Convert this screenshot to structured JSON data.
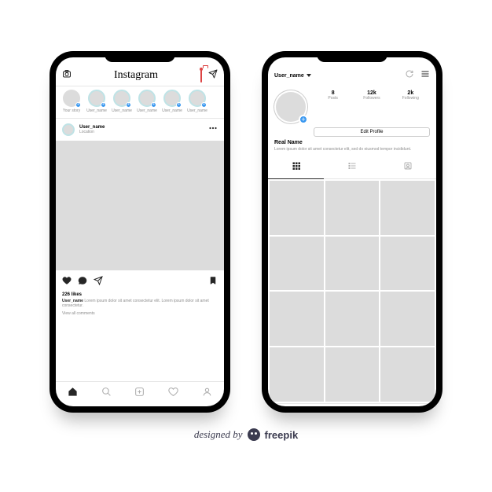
{
  "feed": {
    "app_title": "Instagram",
    "stories": [
      {
        "label": "Your story"
      },
      {
        "label": "User_name"
      },
      {
        "label": "User_name"
      },
      {
        "label": "User_name"
      },
      {
        "label": "User_name"
      },
      {
        "label": "User_name"
      }
    ],
    "post": {
      "username": "User_name",
      "location": "Location",
      "likes": "226 likes",
      "caption_user": "User_name",
      "caption": "Lorem ipsum dolor sit amet consectetur elit. Lorem ipsum dolor sit amet consectetur.",
      "view_comments": "View all comments"
    }
  },
  "profile": {
    "username": "User_name",
    "stats": [
      {
        "value": "8",
        "label": "Posts"
      },
      {
        "value": "12k",
        "label": "Followers"
      },
      {
        "value": "2k",
        "label": "Following"
      }
    ],
    "edit_label": "Edit Profile",
    "real_name": "Real Name",
    "bio": "Lorem ipsum dolor sit amet consectetur elit, sed do eiusmod tempor incididunt."
  },
  "attribution": {
    "prefix": "designed by",
    "brand": "freepik"
  }
}
